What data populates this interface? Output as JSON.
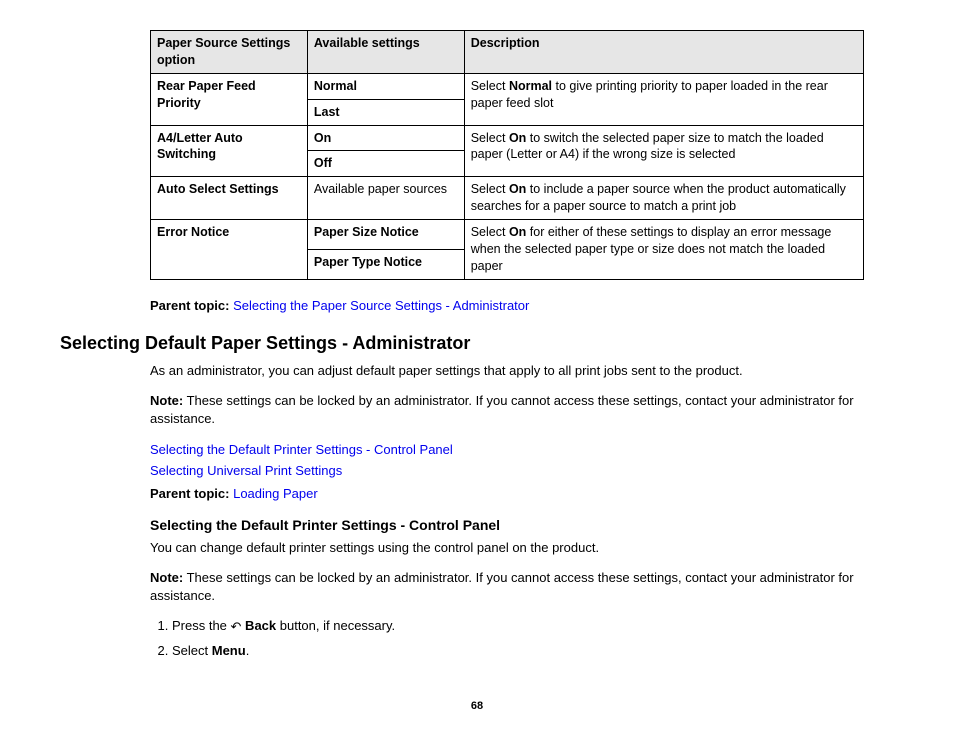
{
  "table": {
    "headers": [
      "Paper Source Settings option",
      "Available settings",
      "Description"
    ],
    "rows": [
      {
        "option": "Rear Paper Feed Priority",
        "settings": [
          "Normal",
          "Last"
        ],
        "desc_prefix": "Select ",
        "desc_bold": "Normal",
        "desc_suffix": " to give printing priority to paper loaded in the rear paper feed slot"
      },
      {
        "option": "A4/Letter Auto Switching",
        "settings": [
          "On",
          "Off"
        ],
        "desc_prefix": "Select ",
        "desc_bold": "On",
        "desc_suffix": " to switch the selected paper size to match the loaded paper (Letter or A4) if the wrong size is selected"
      },
      {
        "option": "Auto Select Settings",
        "settings_plain": "Available paper sources",
        "desc_prefix": "Select ",
        "desc_bold": "On",
        "desc_suffix": " to include a paper source when the product automatically searches for a paper source to match a print job"
      },
      {
        "option": "Error Notice",
        "settings": [
          "Paper Size Notice",
          "Paper Type Notice"
        ],
        "desc_prefix": "Select ",
        "desc_bold": "On",
        "desc_suffix": " for either of these settings to display an error message when the selected paper type or size does not match the loaded paper"
      }
    ]
  },
  "parent1_label": "Parent topic:",
  "parent1_link": "Selecting the Paper Source Settings - Administrator",
  "h2": "Selecting Default Paper Settings - Administrator",
  "p1": "As an administrator, you can adjust default paper settings that apply to all print jobs sent to the product.",
  "note_label": "Note:",
  "note_text": " These settings can be locked by an administrator. If you cannot access these settings, contact your administrator for assistance.",
  "link1": "Selecting the Default Printer Settings - Control Panel",
  "link2": "Selecting Universal Print Settings",
  "parent2_label": "Parent topic:",
  "parent2_link": "Loading Paper",
  "h3": "Selecting the Default Printer Settings - Control Panel",
  "p2": "You can change default printer settings using the control panel on the product.",
  "step1_prefix": "Press the ",
  "step1_bold": " Back",
  "step1_suffix": " button, if necessary.",
  "step2_prefix": "Select ",
  "step2_bold": "Menu",
  "step2_suffix": ".",
  "page_number": "68"
}
